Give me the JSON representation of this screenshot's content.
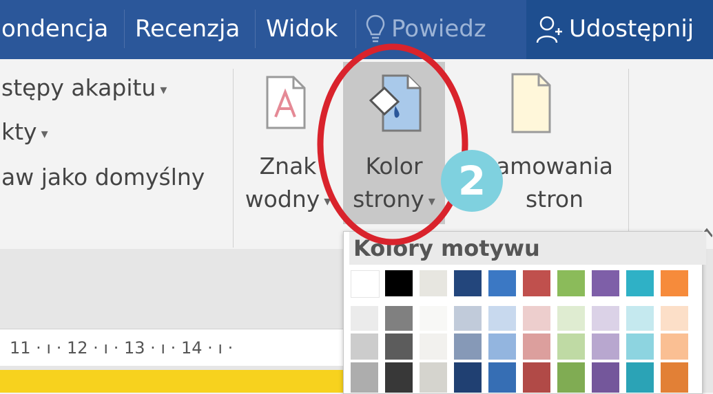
{
  "tabs": [
    {
      "label": "ondencja"
    },
    {
      "label": "Recenzja"
    },
    {
      "label": "Widok"
    }
  ],
  "tell_me": {
    "label": "Powiedz"
  },
  "share": {
    "label": "Udostępnij"
  },
  "left_group": {
    "items": [
      {
        "label": "stępy akapitu"
      },
      {
        "label": "kty"
      },
      {
        "label": "aw jako domyślny"
      }
    ]
  },
  "page_background": {
    "watermark": {
      "line1": "Znak",
      "line2": "wodny"
    },
    "page_color": {
      "line1": "Kolor",
      "line2": "strony"
    },
    "page_borders": {
      "line1": "amowania",
      "line2": "stron"
    }
  },
  "badge": {
    "number": "2"
  },
  "dropdown": {
    "title": "Kolory motywu",
    "theme_colors": [
      "#ffffff",
      "#000000",
      "#e7e6e0",
      "#23467c",
      "#3b78c4",
      "#c0504d",
      "#8bbb5a",
      "#7e5fa8",
      "#2fb1c6",
      "#f68b3b"
    ]
  },
  "ruler": {
    "text": "11 · ı · 12 · ı · 13 · ı · 14 · ı ·"
  },
  "colors": {
    "ribbon_blue": "#2b579a",
    "annotation_red": "#d9232c",
    "badge_teal": "#7fd1df"
  }
}
